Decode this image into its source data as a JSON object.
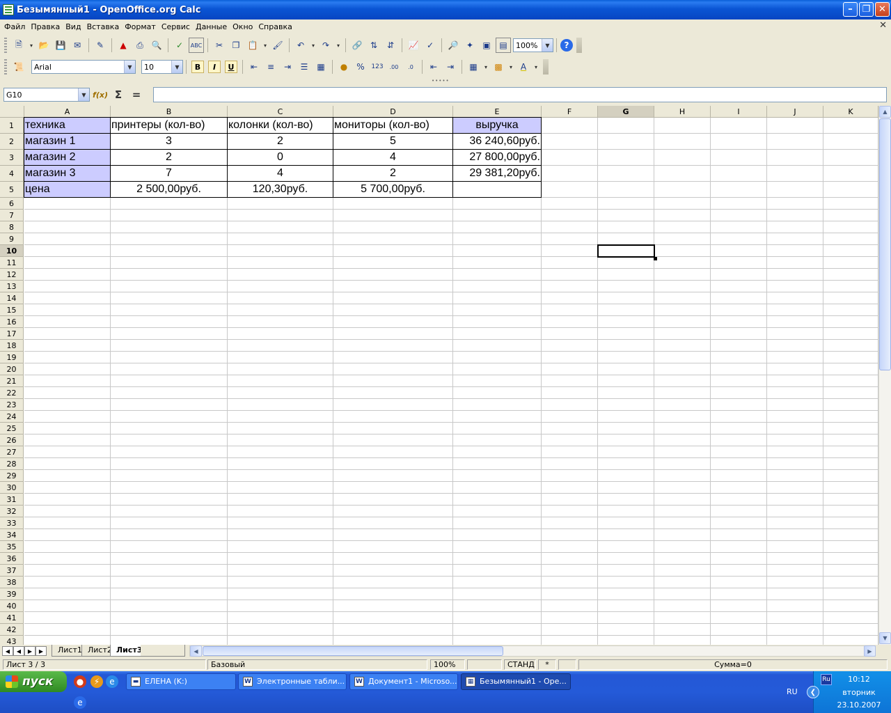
{
  "window": {
    "title": "Безымянный1 - OpenOffice.org Calc"
  },
  "menu": [
    "Файл",
    "Правка",
    "Вид",
    "Вставка",
    "Формат",
    "Сервис",
    "Данные",
    "Окно",
    "Справка"
  ],
  "toolbar": {
    "zoom": "100%",
    "font_name": "Arial",
    "font_size": "10",
    "bold": "B",
    "italic": "I",
    "underline": "U"
  },
  "formula_bar": {
    "name_box": "G10",
    "content": ""
  },
  "columns": [
    "A",
    "B",
    "C",
    "D",
    "E",
    "F",
    "G",
    "H",
    "I",
    "J",
    "K"
  ],
  "selected_column": "G",
  "selected_row": 10,
  "table": {
    "header": [
      "техника",
      "принтеры (кол-во)",
      "колонки (кол-во)",
      "мониторы (кол-во)",
      "выручка"
    ],
    "rows": [
      [
        "магазин 1",
        "3",
        "2",
        "5",
        "36 240,60руб."
      ],
      [
        "магазин 2",
        "2",
        "0",
        "4",
        "27 800,00руб."
      ],
      [
        "магазин 3",
        "7",
        "4",
        "2",
        "29 381,20руб."
      ],
      [
        "цена",
        "2 500,00руб.",
        "120,30руб.",
        "5 700,00руб.",
        ""
      ]
    ]
  },
  "sheet_tabs": [
    "Лист1",
    "Лист2",
    "Лист3"
  ],
  "active_sheet": "Лист3",
  "status": {
    "sheet": "Лист 3 / 3",
    "style": "Базовый",
    "zoom": "100%",
    "mode": "СТАНД",
    "modified": "*",
    "sum": "Сумма=0"
  },
  "taskbar": {
    "start": "пуск",
    "tasks": [
      "ЕЛЕНА (K:)",
      "Электронные табли...",
      "Документ1 - Microso...",
      "Безымянный1 - Ope..."
    ],
    "lang": "RU",
    "kbd": "Ru",
    "time": "10:12",
    "weekday": "вторник",
    "date": "23.10.2007"
  }
}
